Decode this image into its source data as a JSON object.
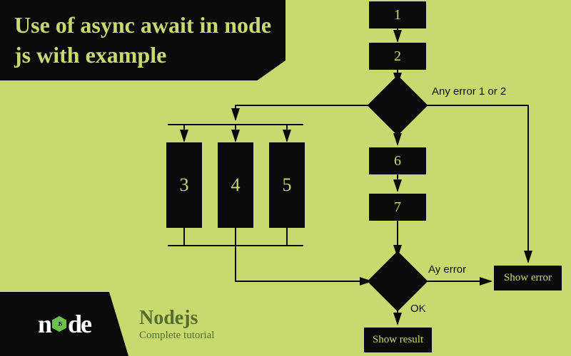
{
  "title": "Use of async await in node js with example",
  "footer": {
    "logo_text": "node",
    "title": "Nodejs",
    "subtitle": "Complete tutorial"
  },
  "chart_data": {
    "type": "flowchart",
    "nodes": [
      {
        "id": "1",
        "label": "1",
        "shape": "rect"
      },
      {
        "id": "2",
        "label": "2",
        "shape": "rect"
      },
      {
        "id": "d1",
        "label": "",
        "shape": "diamond"
      },
      {
        "id": "3",
        "label": "3",
        "shape": "rect"
      },
      {
        "id": "4",
        "label": "4",
        "shape": "rect"
      },
      {
        "id": "5",
        "label": "5",
        "shape": "rect"
      },
      {
        "id": "6",
        "label": "6",
        "shape": "rect"
      },
      {
        "id": "7",
        "label": "7",
        "shape": "rect"
      },
      {
        "id": "d2",
        "label": "",
        "shape": "diamond"
      },
      {
        "id": "result",
        "label": "Show result",
        "shape": "rect"
      },
      {
        "id": "error",
        "label": "Show error",
        "shape": "rect"
      }
    ],
    "edges": [
      {
        "from": "1",
        "to": "2"
      },
      {
        "from": "2",
        "to": "d1"
      },
      {
        "from": "d1",
        "to": "3",
        "branch": "ok"
      },
      {
        "from": "d1",
        "to": "4",
        "branch": "ok"
      },
      {
        "from": "d1",
        "to": "5",
        "branch": "ok"
      },
      {
        "from": "d1",
        "to": "6"
      },
      {
        "from": "d1",
        "to": "error",
        "label": "Any error 1 or 2"
      },
      {
        "from": "6",
        "to": "7"
      },
      {
        "from": "7",
        "to": "d2"
      },
      {
        "from": "3",
        "to": "d2"
      },
      {
        "from": "4",
        "to": "d2"
      },
      {
        "from": "5",
        "to": "d2"
      },
      {
        "from": "d2",
        "to": "result",
        "label": "OK"
      },
      {
        "from": "d2",
        "to": "error",
        "label": "Ay error"
      }
    ],
    "labels": {
      "error_branch_1": "Any error 1 or 2",
      "error_branch_2": "Ay error",
      "ok_branch": "OK"
    }
  }
}
